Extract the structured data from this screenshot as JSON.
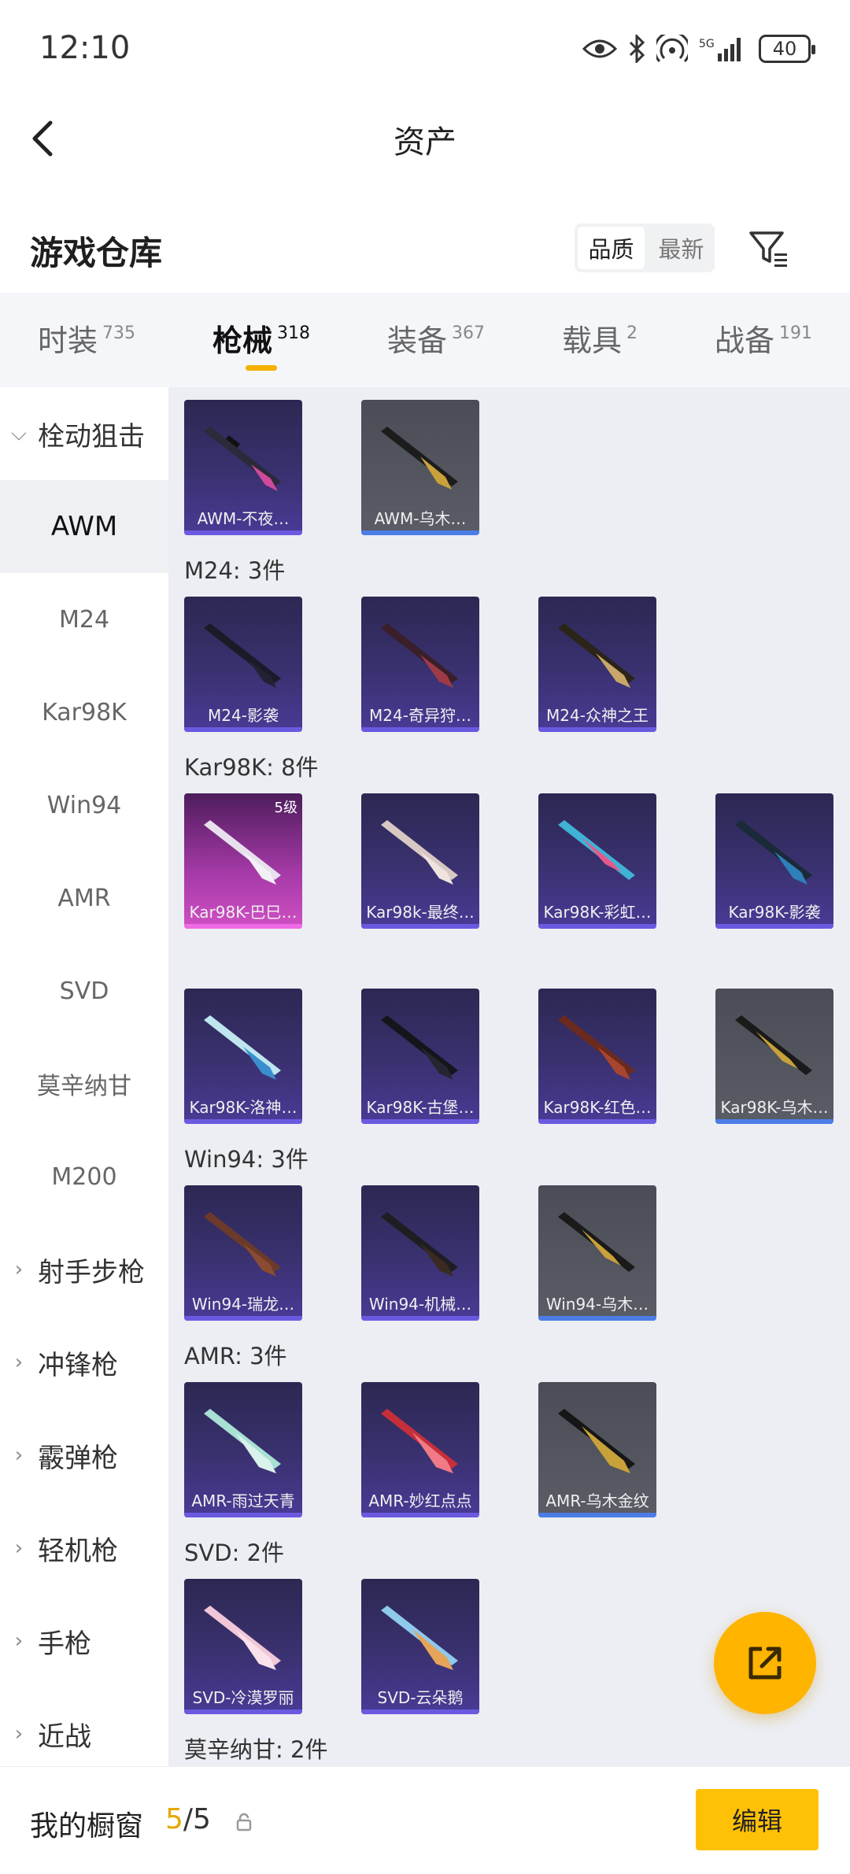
{
  "status": {
    "time": "12:10",
    "battery": "40",
    "network": "5G"
  },
  "header": {
    "title": "资产"
  },
  "subheader": {
    "title": "游戏仓库",
    "sort_quality": "品质",
    "sort_latest": "最新"
  },
  "tabs": [
    {
      "label": "时装",
      "count": "735"
    },
    {
      "label": "枪械",
      "count": "318"
    },
    {
      "label": "装备",
      "count": "367"
    },
    {
      "label": "载具",
      "count": "2"
    },
    {
      "label": "战备",
      "count": "191"
    }
  ],
  "sidebar": {
    "category_open": "栓动狙击",
    "subs": [
      "AWM",
      "M24",
      "Kar98K",
      "Win94",
      "AMR",
      "SVD",
      "莫辛纳甘",
      "M200"
    ],
    "categories": [
      "射手步枪",
      "冲锋枪",
      "霰弹枪",
      "轻机枪",
      "手枪",
      "近战"
    ]
  },
  "groups": {
    "m24": "M24: 3件",
    "kar98k": "Kar98K: 8件",
    "win94": "Win94: 3件",
    "amr": "AMR: 3件",
    "svd": "SVD: 2件",
    "mosin": "莫辛纳甘: 2件"
  },
  "items": {
    "awm_1": "AWM-不夜…",
    "awm_2": "AWM-乌木…",
    "m24_1": "M24-影袭",
    "m24_2": "M24-奇异狩…",
    "m24_3": "M24-众神之王",
    "kar_1": "Kar98K-巴巳…",
    "kar_1_badge": "5级",
    "kar_2": "Kar98k-最终…",
    "kar_3": "Kar98K-彩虹…",
    "kar_4": "Kar98K-影袭",
    "kar_5": "Kar98K-洛神…",
    "kar_6": "Kar98K-古堡…",
    "kar_7": "Kar98K-红色…",
    "kar_8": "Kar98K-乌木…",
    "win_1": "Win94-瑞龙…",
    "win_2": "Win94-机械…",
    "win_3": "Win94-乌木…",
    "amr_1": "AMR-雨过天青",
    "amr_2": "AMR-妙红点点",
    "amr_3": "AMR-乌木金纹",
    "svd_1": "SVD-冷漠罗丽",
    "svd_2": "SVD-云朵鹅"
  },
  "bottom": {
    "label": "我的橱窗",
    "current": "5",
    "total": "/5",
    "edit": "编辑"
  },
  "colors": {
    "accent": "#ffb400",
    "edit_button": "#ffc107",
    "tab_indicator": "#f5b100"
  }
}
